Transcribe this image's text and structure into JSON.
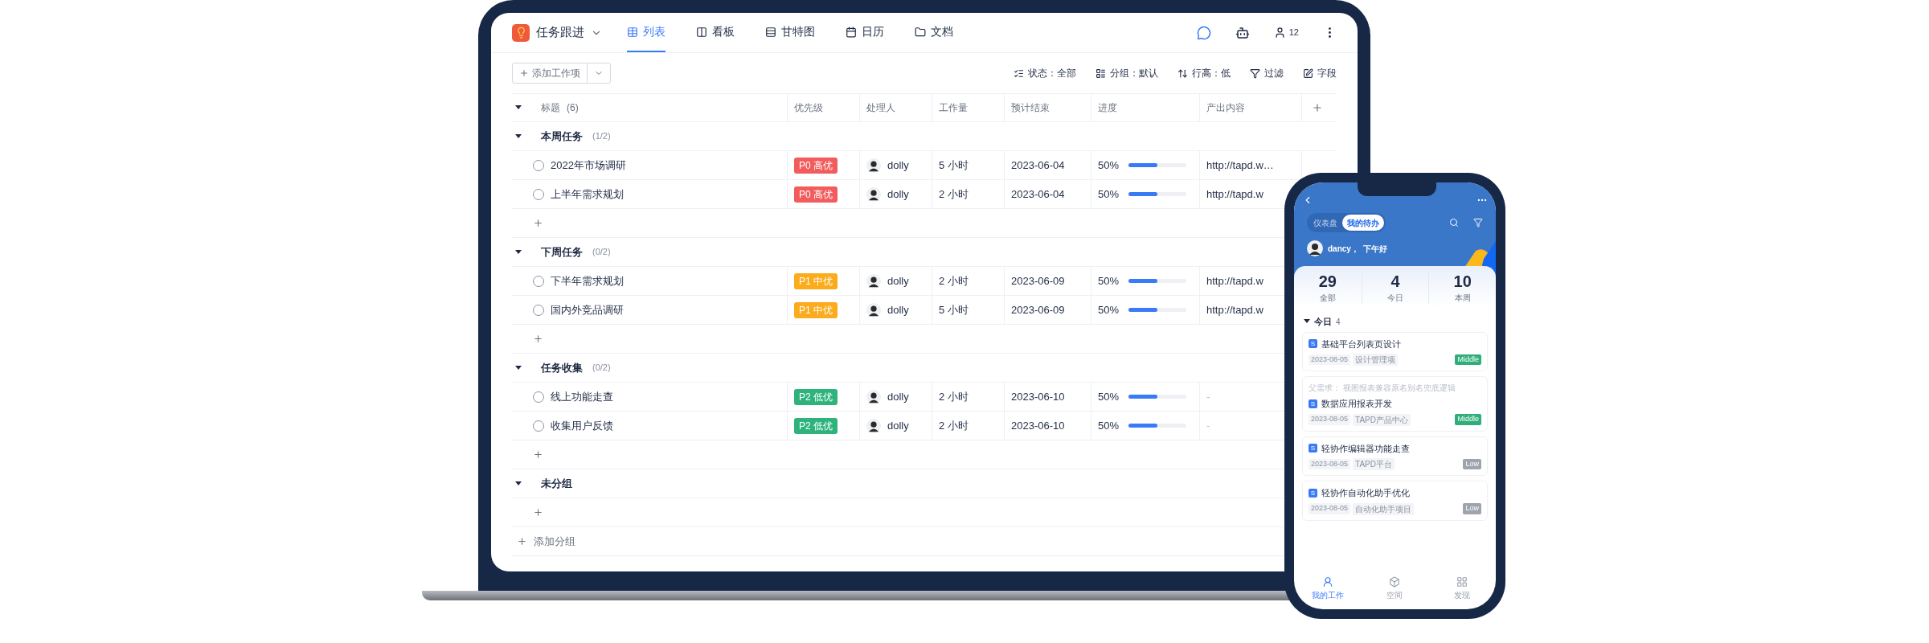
{
  "app": {
    "title": "任务跟进",
    "tabs": [
      {
        "label": "列表",
        "selected": true
      },
      {
        "label": "看板",
        "selected": false
      },
      {
        "label": "甘特图",
        "selected": false
      },
      {
        "label": "日历",
        "selected": false
      },
      {
        "label": "文档",
        "selected": false
      }
    ],
    "member_count": "12"
  },
  "toolbar": {
    "add_button": "添加工作项",
    "options": [
      "状态：全部",
      "分组：默认",
      "行高：低",
      "过滤",
      "字段"
    ]
  },
  "table": {
    "columns": [
      {
        "label": "标题",
        "count": "(6)"
      },
      {
        "label": "优先级"
      },
      {
        "label": "处理人"
      },
      {
        "label": "工作量"
      },
      {
        "label": "预计结束"
      },
      {
        "label": "进度"
      },
      {
        "label": "产出内容"
      }
    ],
    "groups": [
      {
        "name": "本周任务",
        "count": "(1/2)",
        "expanded": true,
        "tasks": [
          {
            "title": "2022年市场调研",
            "done": false,
            "priority": "P0 高优",
            "color": "#f25c5c",
            "assignee": "dolly",
            "effort": "5 小时",
            "due": "2023-06-04",
            "progress": "50%",
            "level": 0.5,
            "output": "http://tapd.w…"
          },
          {
            "title": "上半年需求规划",
            "done": false,
            "priority": "P0 高优",
            "color": "#f25c5c",
            "assignee": "dolly",
            "effort": "2 小时",
            "due": "2023-06-04",
            "progress": "50%",
            "level": 0.5,
            "output": "http://tapd.w"
          }
        ]
      },
      {
        "name": "下周任务",
        "count": "(0/2)",
        "expanded": true,
        "tasks": [
          {
            "title": "下半年需求规划",
            "done": false,
            "priority": "P1 中优",
            "color": "#fbab1b",
            "assignee": "dolly",
            "effort": "2 小时",
            "due": "2023-06-09",
            "progress": "50%",
            "level": 0.5,
            "output": "http://tapd.w"
          },
          {
            "title": "国内外竞品调研",
            "done": false,
            "priority": "P1 中优",
            "color": "#fbab1b",
            "assignee": "dolly",
            "effort": "5 小时",
            "due": "2023-06-09",
            "progress": "50%",
            "level": 0.5,
            "output": "http://tapd.w"
          }
        ]
      },
      {
        "name": "任务收集",
        "count": "(0/2)",
        "expanded": true,
        "tasks": [
          {
            "title": "线上功能走查",
            "done": false,
            "priority": "P2 低优",
            "color": "#2eb37c",
            "assignee": "dolly",
            "effort": "2 小时",
            "due": "2023-06-10",
            "progress": "50%",
            "level": 0.5,
            "output": "-"
          },
          {
            "title": "收集用户反馈",
            "done": false,
            "priority": "P2 低优",
            "color": "#2eb37c",
            "assignee": "dolly",
            "effort": "2 小时",
            "due": "2023-06-10",
            "progress": "50%",
            "level": 0.5,
            "output": "-"
          }
        ]
      },
      {
        "name": "未分组",
        "expanded": true
      }
    ],
    "add_group": "添加分组"
  },
  "phone": {
    "segments": [
      {
        "label": "仪表盘",
        "selected": false
      },
      {
        "label": "我的待办",
        "selected": true
      }
    ],
    "greeting": "dancy，  下午好",
    "stats": [
      {
        "value": "29",
        "label": "全部"
      },
      {
        "value": "4",
        "label": "今日"
      },
      {
        "value": "10",
        "label": "本周"
      }
    ],
    "section": {
      "label": "今日",
      "count": "4",
      "expanded": true
    },
    "cards": [
      {
        "badge": "S",
        "title": "基础平台列表页设计",
        "date": "2023-08-05",
        "project": "设计管理项",
        "tag": "Middle",
        "color": "#2fae7a"
      },
      {
        "parent": "父需求：  视图报表兼容原名别名兜底逻辑",
        "badge": "S",
        "title": "数据应用报表开发",
        "date": "2023-08-05",
        "project": "TAPD产品中心",
        "tag": "Middle",
        "color": "#2fae7a"
      },
      {
        "badge": "S",
        "title": "轻协作编辑器功能走查",
        "date": "2023-08-05",
        "project": "TAPD平台",
        "tag": "Low",
        "color": "#9ea4ae"
      },
      {
        "badge": "S",
        "title": "轻协作自动化助手优化",
        "date": "2023-08-05",
        "project": "自动化助手项目",
        "tag": "Low",
        "color": "#9ea4ae"
      }
    ],
    "nav": [
      {
        "label": "我的工作",
        "selected": true
      },
      {
        "label": "空间",
        "selected": false
      },
      {
        "label": "发现",
        "selected": false
      }
    ]
  }
}
